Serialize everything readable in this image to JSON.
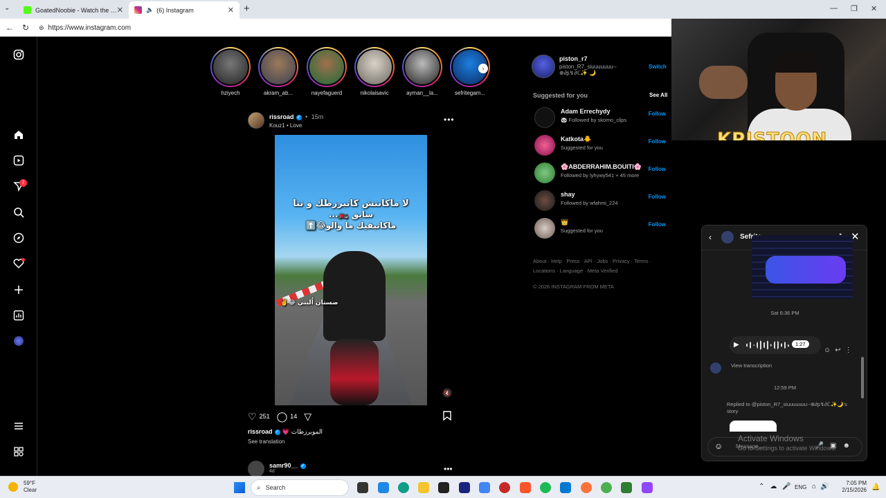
{
  "browser": {
    "tabs": [
      {
        "title": "GoatedNoobie - Watch the VOD o",
        "favicon_color": "#53fc18",
        "active": false
      },
      {
        "title": "(6) Instagram",
        "favicon_color": "#d62976",
        "active": true
      }
    ],
    "url": "https://www.instagram.com"
  },
  "overlay": {
    "brand": "KPISTOON"
  },
  "sidebar": {
    "notification_count": "7"
  },
  "stories": [
    {
      "name": "hziyech"
    },
    {
      "name": "akram_ab..."
    },
    {
      "name": "nayefaguerd"
    },
    {
      "name": "nikolaisavic"
    },
    {
      "name": "ayman__la..."
    },
    {
      "name": "sefritegam..."
    }
  ],
  "post": {
    "user": "rissroad",
    "time": "15m",
    "audio": "Kouz1 • Love",
    "overlay_text_1": "لا ماكانتش كاتبرزطك و نتا",
    "overlay_text_2": "سايق 🏍️...",
    "overlay_text_3": "ماكاتبقيك ما والو😂⬆️",
    "overlay_text_4": "ضستان اُلبني 😂✌️",
    "likes": "251",
    "comments": "14",
    "caption_user": "rissroad",
    "caption_text": "💗 الموبرزطات",
    "see_translation": "See translation",
    "next_user": "samr90__",
    "next_time": "4d"
  },
  "right": {
    "me_user": "piston_r7",
    "me_full": "piston_R7_siuuuuuuu--⊕∂ʂ↯∂ℂ✨ 🌙",
    "switch": "Switch",
    "suggested_title": "Suggested for you",
    "see_all": "See All",
    "suggestions": [
      {
        "user": "Adam Errechydy",
        "sub": "🐼 Followed by skorno_clips",
        "color": "#111"
      },
      {
        "user": "Katkota🐥",
        "sub": "Suggested for you",
        "color": "#c2185b"
      },
      {
        "user": "🌸ABDERRAHIM.BOUITI🌸",
        "sub": "Followed by lyhywy541 + 45 more",
        "color": "#4caf50"
      },
      {
        "user": "shay",
        "sub": "Followed by wfahmi_224",
        "color": "#3e2a20"
      },
      {
        "user": "👑",
        "sub": "Suggested for you",
        "color": "#8c7a6a"
      }
    ],
    "follow": "Follow",
    "footer": "About · Help · Press · API · Jobs · Privacy · Terms · Locations · Language · Meta Verified",
    "copyright": "© 2026 INSTAGRAM FROM META"
  },
  "chat": {
    "name": "Sefrite",
    "stamp1": "Sat 6:36 PM",
    "voice_duration": "1:27",
    "view_transcription": "View transcription",
    "stamp2": "12:59 PM",
    "replied": "Replied to @piston_R7_siuuuuuuu--⊕∂ʂ↯∂ℂ✨🌙's story",
    "placeholder": "Message..."
  },
  "watermark": {
    "line1": "Activate Windows",
    "line2": "Go to Settings to activate Windows."
  },
  "taskbar": {
    "temp": "59°F",
    "weather": "Clear",
    "search": "Search",
    "lang": "ENG",
    "time": "7:05 PM",
    "date": "2/15/2026"
  }
}
